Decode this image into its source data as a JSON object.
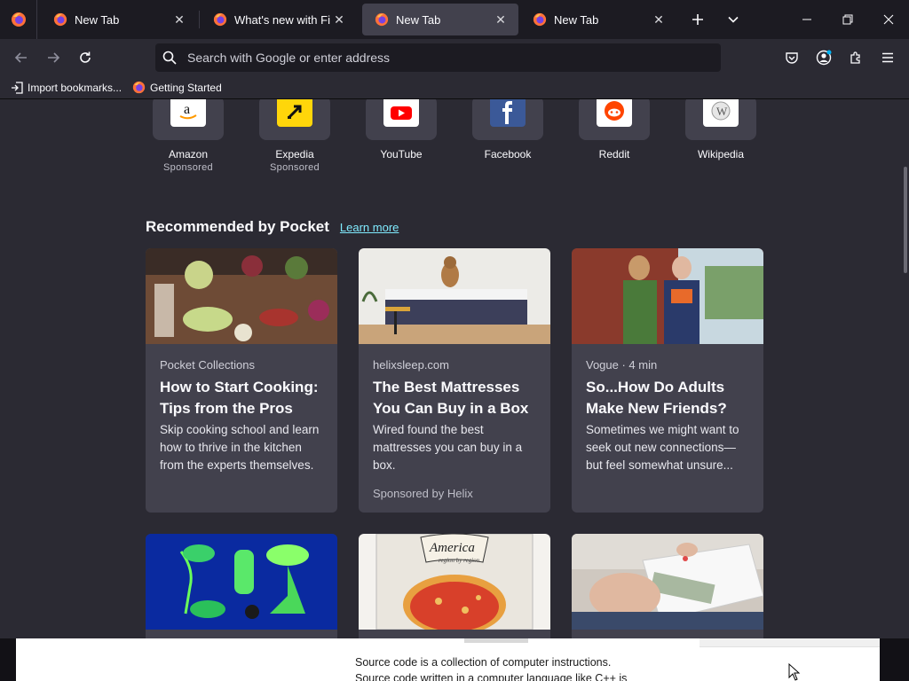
{
  "tabs": [
    {
      "title": "New Tab",
      "selected": false
    },
    {
      "title": "What's new with Firefo",
      "selected": false
    },
    {
      "title": "New Tab",
      "selected": true
    },
    {
      "title": "New Tab",
      "selected": false
    }
  ],
  "urlbar": {
    "placeholder": "Search with Google or enter address"
  },
  "bookmarks": [
    {
      "label": "Import bookmarks...",
      "icon": "import-icon"
    },
    {
      "label": "Getting Started",
      "icon": "firefox-icon"
    }
  ],
  "top_sites": [
    {
      "name": "Amazon",
      "sponsor": "Sponsored",
      "color": "#ffffff"
    },
    {
      "name": "Expedia",
      "sponsor": "Sponsored",
      "color": "#ffd60a"
    },
    {
      "name": "YouTube",
      "sponsor": "",
      "color": "#ffffff"
    },
    {
      "name": "Facebook",
      "sponsor": "",
      "color": "#3b5998"
    },
    {
      "name": "Reddit",
      "sponsor": "",
      "color": "#ffffff"
    },
    {
      "name": "Wikipedia",
      "sponsor": "",
      "color": "#ffffff"
    }
  ],
  "pocket": {
    "title": "Recommended by Pocket",
    "learn_more": "Learn more",
    "cards": [
      {
        "source": "Pocket Collections",
        "title": "How to Start Cooking: Tips from the Pros",
        "excerpt": "Skip cooking school and learn how to thrive in the kitchen from the experts themselves.",
        "sponsor": ""
      },
      {
        "source": "helixsleep.com",
        "title": "The Best Mattresses You Can Buy in a Box",
        "excerpt": "Wired found the best mattresses you can buy in a box.",
        "sponsor": "Sponsored by Helix"
      },
      {
        "source": "Vogue · 4 min",
        "title": "So...How Do Adults Make New Friends?",
        "excerpt": "Sometimes we might want to seek out new connections—but feel somewhat unsure...",
        "sponsor": ""
      }
    ],
    "second_row": [
      {
        "image_text": ""
      },
      {
        "image_text": "America\nregion by region"
      },
      {
        "image_text": ""
      }
    ]
  },
  "overlay": {
    "line1": "Source code is a collection of computer instructions.",
    "line2": "Source code written in a computer language like C++ is"
  },
  "colors": {
    "accent": "#80ebff",
    "tab_selected": "#42414d",
    "chrome": "#2b2a33"
  }
}
